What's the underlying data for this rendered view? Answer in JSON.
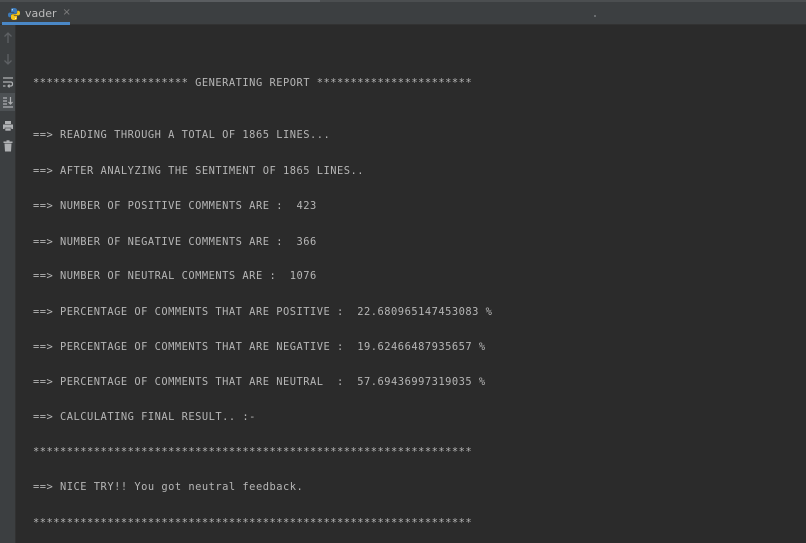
{
  "tab": {
    "title": "vader",
    "close_glyph": "×",
    "icon": "python-file-icon"
  },
  "colors": {
    "background": "#2b2b2b",
    "toolbar": "#3c3f41",
    "text": "#b6b6b6",
    "tab_accent": "#4a88c7"
  },
  "toolbar": {
    "icons": [
      "up-arrow-icon",
      "down-arrow-icon",
      "soft-wrap-icon",
      "scroll-to-end-icon",
      "print-icon",
      "trash-icon"
    ]
  },
  "console": {
    "lines": [
      "*********************** GENERATING REPORT ***********************",
      "==> READING THROUGH A TOTAL OF 1865 LINES...",
      "==> AFTER ANALYZING THE SENTIMENT OF 1865 LINES..",
      "==> NUMBER OF POSITIVE COMMENTS ARE :  423",
      "==> NUMBER OF NEGATIVE COMMENTS ARE :  366",
      "==> NUMBER OF NEUTRAL COMMENTS ARE :  1076",
      "==> PERCENTAGE OF COMMENTS THAT ARE POSITIVE :  22.680965147453083 %",
      "==> PERCENTAGE OF COMMENTS THAT ARE NEGATIVE :  19.62466487935657 %",
      "==> PERCENTAGE OF COMMENTS THAT ARE NEUTRAL  :  57.69436997319035 %",
      "==> CALCULATING FINAL RESULT.. :-",
      "*****************************************************************",
      "==> NICE TRY!! You got neutral feedback.",
      "*****************************************************************"
    ]
  }
}
